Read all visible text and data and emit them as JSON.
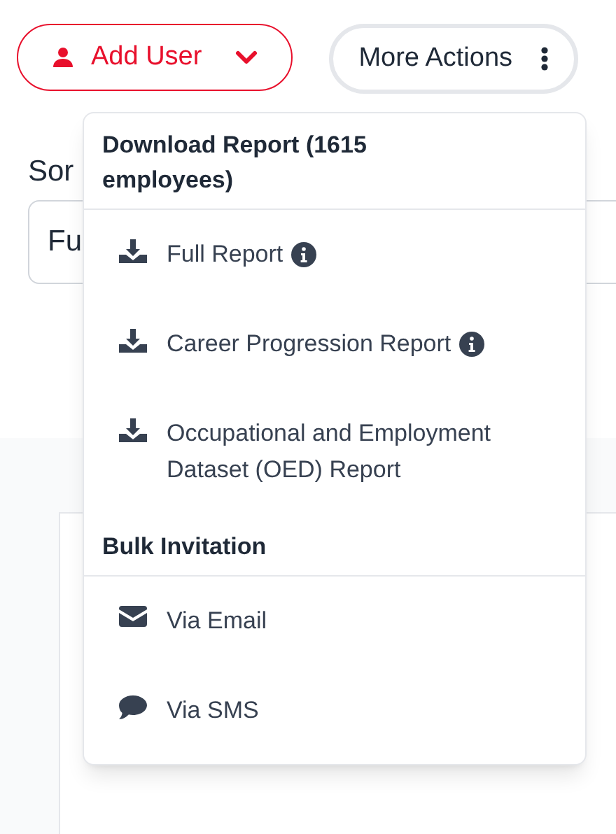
{
  "buttons": [
    {
      "label": "Add User",
      "kind": "primary"
    },
    {
      "label": "More Actions",
      "kind": "menu"
    }
  ],
  "sort": {
    "label": "Sor",
    "value": "Fu"
  },
  "menu": {
    "sections": [
      {
        "title": "Download Report (1615 employees)",
        "items": [
          {
            "label": "Full Report",
            "kind": "download",
            "info": true
          },
          {
            "label": "Career Progression Report",
            "kind": "download",
            "info": true
          },
          {
            "label": "Occupational and Employment Dataset (OED) Report",
            "kind": "download",
            "info": false
          }
        ]
      },
      {
        "title": "Bulk Invitation",
        "items": [
          {
            "label": "Via Email",
            "kind": "email",
            "info": false
          },
          {
            "label": "Via SMS",
            "kind": "sms",
            "info": false
          }
        ]
      }
    ]
  }
}
